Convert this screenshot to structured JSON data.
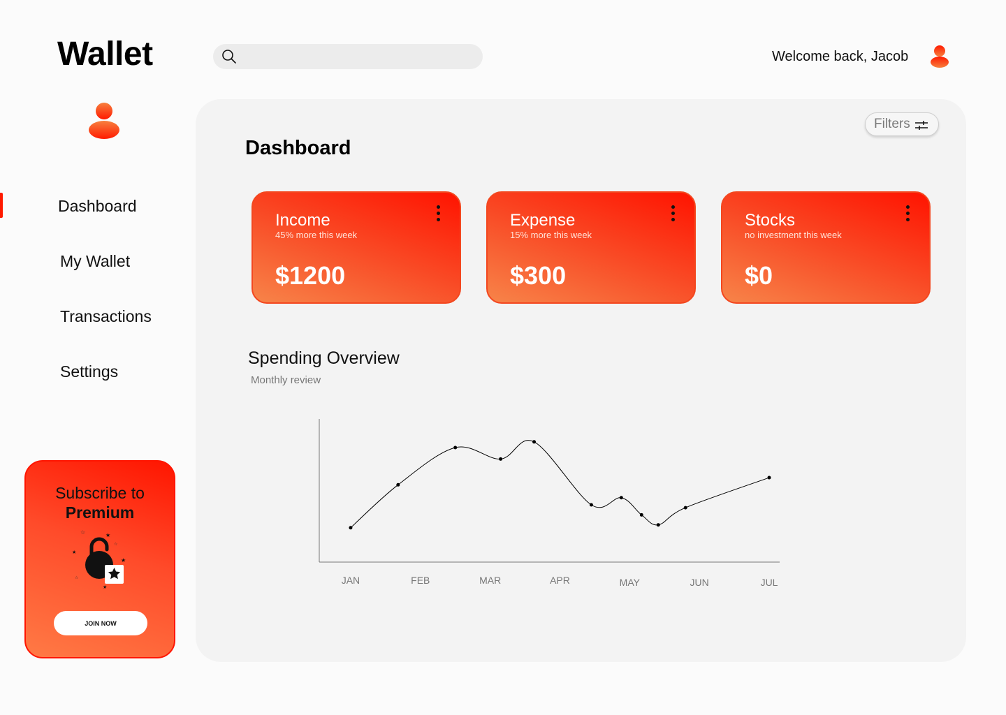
{
  "app": {
    "title": "Wallet"
  },
  "header": {
    "search_placeholder": "",
    "welcome": "Welcome back, Jacob"
  },
  "sidebar": {
    "items": [
      {
        "label": "Dashboard",
        "active": true
      },
      {
        "label": "My Wallet",
        "active": false
      },
      {
        "label": "Transactions",
        "active": false
      },
      {
        "label": "Settings",
        "active": false
      }
    ]
  },
  "premium": {
    "line1": "Subscribe to",
    "line2": "Premium",
    "button": "JOIN NOW"
  },
  "main": {
    "title": "Dashboard",
    "filters_label": "Filters",
    "cards": [
      {
        "title": "Income",
        "subtitle": "45% more this week",
        "value": "$1200"
      },
      {
        "title": "Expense",
        "subtitle": "15% more this week",
        "value": "$300"
      },
      {
        "title": "Stocks",
        "subtitle": "no investment this week",
        "value": "$0"
      }
    ]
  },
  "chart": {
    "title": "Spending Overview",
    "subtitle": "Monthly review"
  },
  "chart_data": {
    "type": "line",
    "title": "Spending Overview",
    "subtitle": "Monthly review",
    "categories": [
      "JAN",
      "FEB",
      "MAR",
      "APR",
      "MAY",
      "JUN",
      "JUL"
    ],
    "x": [
      0.0,
      0.68,
      1.5,
      2.15,
      2.63,
      3.45,
      3.88,
      4.17,
      4.41,
      4.8,
      6.0
    ],
    "y": [
      24,
      54,
      80,
      72,
      84,
      40,
      45,
      33,
      26,
      38,
      59
    ],
    "xlim": [
      -0.45,
      6.15
    ],
    "ylim": [
      0,
      100
    ],
    "grid": false,
    "colors": {
      "line": "#000000",
      "axis": "#777777"
    }
  },
  "colors": {
    "accent": "#ff1a00",
    "accent_light": "#f78449"
  }
}
